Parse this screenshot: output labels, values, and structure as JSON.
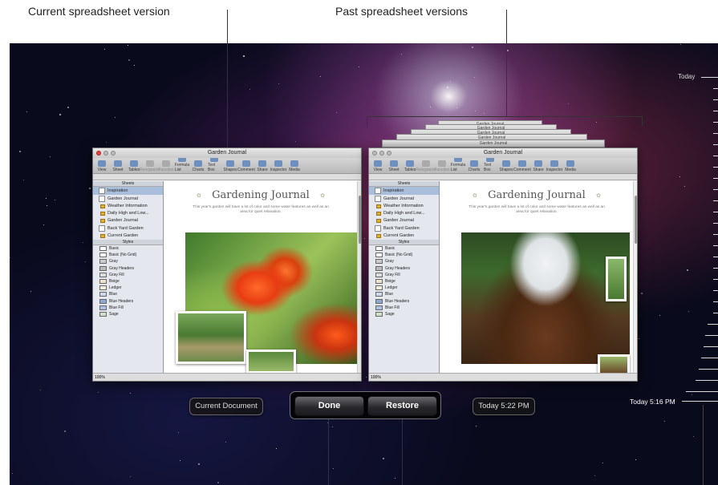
{
  "callouts": {
    "current": "Current spreadsheet version",
    "past": "Past spreadsheet versions"
  },
  "current_window": {
    "title": "Garden Journal",
    "toolbar": [
      "View",
      "Sheet",
      "Tables",
      "Reorganize",
      "Function",
      "Formula List",
      "Charts",
      "Text Box",
      "Shapes",
      "Comment",
      "Share",
      "Inspector",
      "Media"
    ],
    "sheets_header": "Sheets",
    "styles_header": "Styles",
    "zoom": "100%"
  },
  "past_window": {
    "title": "Garden Journal",
    "toolbar": [
      "View",
      "Sheet",
      "Tables",
      "Reorganize",
      "Function",
      "Formula List",
      "Charts",
      "Text Box",
      "Shapes",
      "Comment",
      "Share",
      "Inspector",
      "Media"
    ],
    "sheets_header": "Sheets",
    "styles_header": "Styles",
    "zoom": "100%"
  },
  "past_stack_title": "Garden Journal",
  "sheets": [
    {
      "label": "Inspiration",
      "selected": true
    },
    {
      "label": "Garden Journal",
      "tables": [
        "Weather Information",
        "Daily High and Low...",
        "Garden Journal"
      ]
    },
    {
      "label": "Back Yard Garden",
      "tables": [
        "Current Garden"
      ]
    }
  ],
  "styles": [
    "Basic",
    "Basic (No Grid)",
    "Gray",
    "Gray Headers",
    "Gray Fill",
    "Beige",
    "Ledger",
    "Blue",
    "Blue Headers",
    "Blue Fill",
    "Sage"
  ],
  "document": {
    "title": "Gardening Journal",
    "subtitle": "This year's garden will have a lot of color and some water features as well as an area for quiet relaxation."
  },
  "labels": {
    "current_document": "Current Document",
    "past_timestamp": "Today 5:22 PM"
  },
  "buttons": {
    "done": "Done",
    "restore": "Restore"
  },
  "timeline": {
    "top_label": "Today",
    "marker_label": "Today 5:16 PM"
  },
  "colors": {
    "selected_row": "#a9bedb",
    "background": "#090a1c"
  }
}
